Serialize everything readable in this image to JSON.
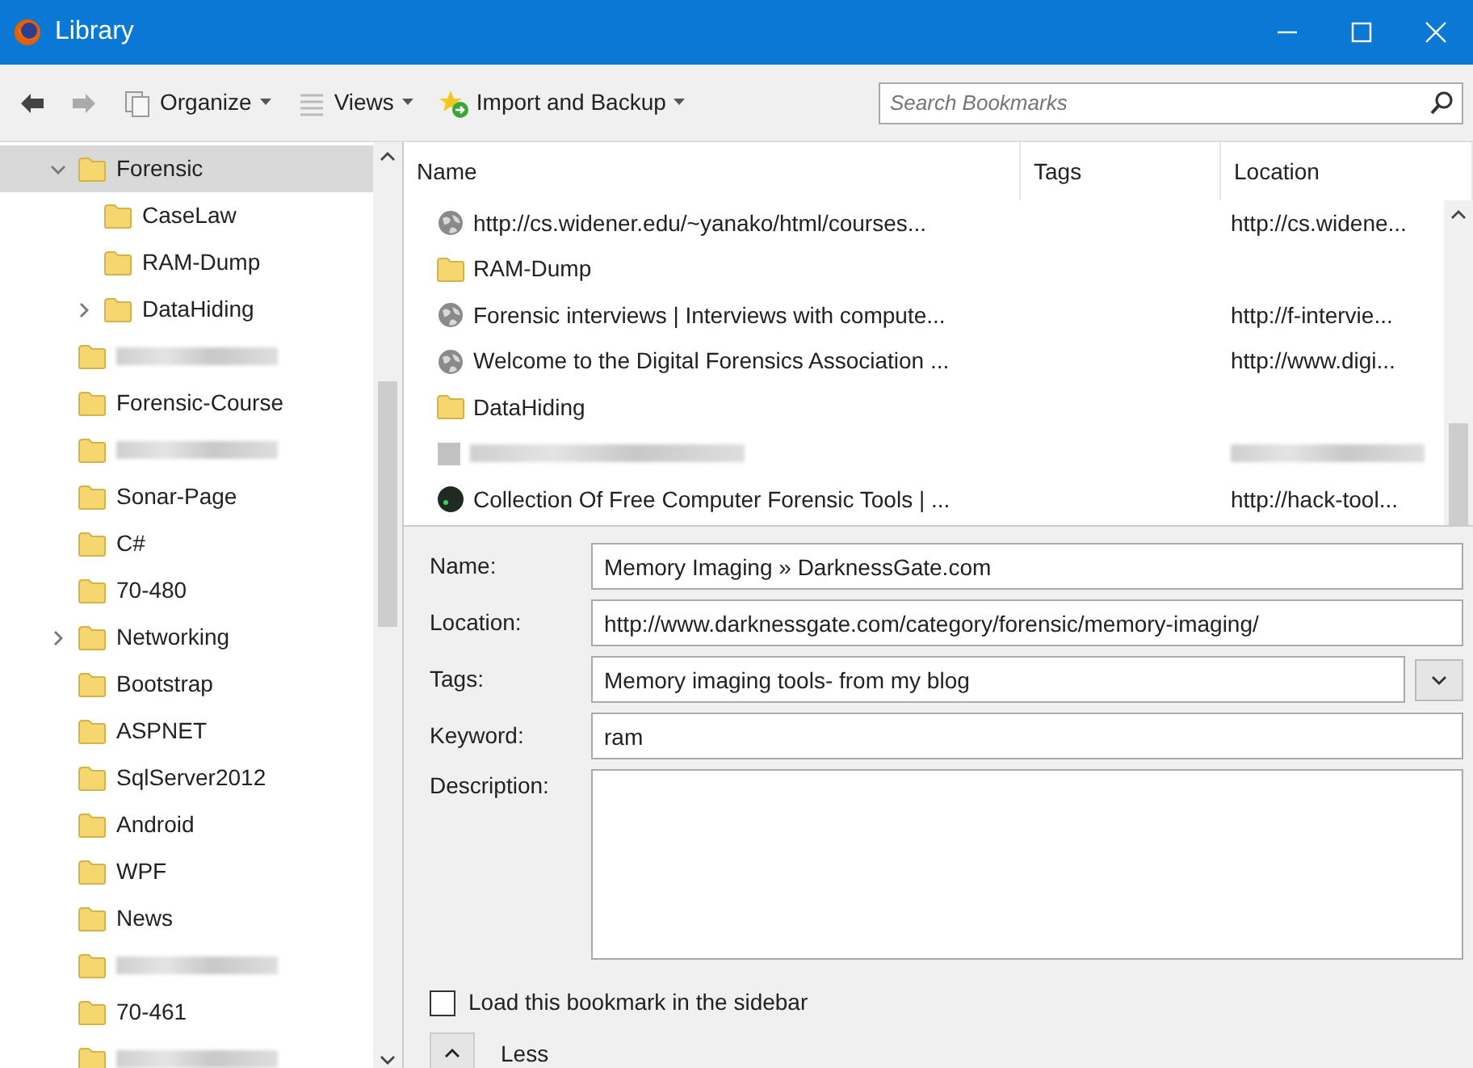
{
  "window": {
    "title": "Library"
  },
  "toolbar": {
    "menus": [
      {
        "label": "Organize"
      },
      {
        "label": "Views"
      },
      {
        "label": "Import and Backup"
      }
    ],
    "search": {
      "placeholder": "Search Bookmarks"
    }
  },
  "sidebar": {
    "items": [
      {
        "label": "Forensic",
        "kind": "folder",
        "selected": true,
        "expanded": true,
        "children": [
          {
            "label": "CaseLaw",
            "kind": "folder",
            "selected": false
          },
          {
            "label": "RAM-Dump",
            "kind": "folder",
            "selected": false
          },
          {
            "label": "DataHiding",
            "kind": "folder",
            "selected": false,
            "expanded": false
          }
        ]
      },
      {
        "kind": "redacted",
        "selected": false
      },
      {
        "label": "Forensic-Course",
        "kind": "folder",
        "selected": false
      },
      {
        "kind": "redacted",
        "selected": false
      },
      {
        "label": "Sonar-Page",
        "kind": "folder",
        "selected": false
      },
      {
        "label": "C#",
        "kind": "folder",
        "selected": false
      },
      {
        "label": "70-480",
        "kind": "folder",
        "selected": false
      },
      {
        "label": "Networking",
        "kind": "folder",
        "selected": false,
        "expanded": false
      },
      {
        "label": "Bootstrap",
        "kind": "folder",
        "selected": false
      },
      {
        "label": "ASPNET",
        "kind": "folder",
        "selected": false
      },
      {
        "label": "SqlServer2012",
        "kind": "folder",
        "selected": false
      },
      {
        "label": "Android",
        "kind": "folder",
        "selected": false
      },
      {
        "label": "WPF",
        "kind": "folder",
        "selected": false
      },
      {
        "label": "News",
        "kind": "folder",
        "selected": false
      },
      {
        "kind": "redacted",
        "selected": false
      },
      {
        "label": "70-461",
        "kind": "folder",
        "selected": false
      },
      {
        "kind": "redacted",
        "selected": false
      }
    ]
  },
  "table": {
    "columns": [
      "Name",
      "Tags",
      "Location"
    ],
    "rows": [
      {
        "kind": "bookmark",
        "name": "http://cs.widener.edu/~yanako/html/courses...",
        "location": "http://cs.widene..."
      },
      {
        "kind": "folder",
        "name": "RAM-Dump"
      },
      {
        "kind": "bookmark",
        "name": "Forensic interviews | Interviews with compute...",
        "location": "http://f-intervie..."
      },
      {
        "kind": "bookmark",
        "name": "Welcome to the Digital Forensics Association ...",
        "location": "http://www.digi..."
      },
      {
        "kind": "folder",
        "name": "DataHiding"
      },
      {
        "kind": "redacted"
      },
      {
        "kind": "favicon",
        "name": "Collection Of Free Computer Forensic Tools | ...",
        "location": "http://hack-tool..."
      }
    ]
  },
  "details": {
    "fields": [
      {
        "label": "Name:",
        "kind": "text",
        "value": "Memory Imaging » DarknessGate.com"
      },
      {
        "label": "Location:",
        "kind": "text",
        "value": "http://www.darknessgate.com/category/forensic/memory-imaging/"
      },
      {
        "label": "Tags:",
        "kind": "combo",
        "value": "Memory imaging tools- from my blog"
      },
      {
        "label": "Keyword:",
        "kind": "text",
        "value": "ram"
      },
      {
        "label": "Description:",
        "kind": "textarea"
      }
    ],
    "sidebar_checkbox": {
      "label": "Load this bookmark in the sidebar",
      "checked": false
    },
    "toggle": {
      "label": "Less",
      "expanded": true
    }
  }
}
